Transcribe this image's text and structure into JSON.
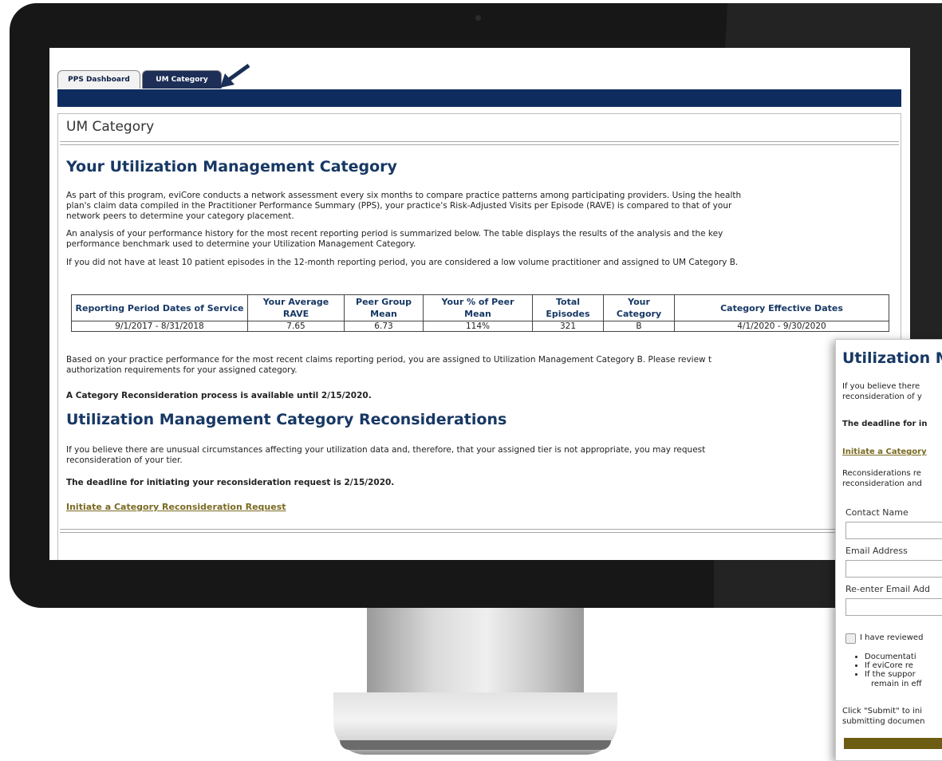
{
  "tabs": [
    {
      "label": "PPS Dashboard"
    },
    {
      "label": "UM Category"
    }
  ],
  "panel": {
    "title": "UM Category"
  },
  "section1": {
    "heading": "Your Utilization Management Category",
    "para1_line1": "As part of this program, eviCore conducts a network assessment every six months to compare practice patterns among participating providers. Using the health",
    "para1_line2": "plan's claim data compiled in the Practitioner Performance Summary (PPS), your practice's Risk-Adjusted Visits per Episode (RAVE) is compared to that of your",
    "para1_line3": "network peers to determine your category placement.",
    "para2_line1": "An analysis of your performance history for the most recent reporting period is summarized below. The table displays the results of the analysis and the key",
    "para2_line2": "performance benchmark used to determine your Utilization Management Category.",
    "para3": "If you did not have at least 10 patient episodes in the 12-month reporting period, you are considered a low volume practitioner and assigned to UM Category B."
  },
  "table": {
    "headers": [
      "Reporting Period Dates of Service",
      "Your Average RAVE",
      "Peer Group Mean",
      "Your % of Peer Mean",
      "Total Episodes",
      "Your Category",
      "Category Effective Dates"
    ],
    "rows": [
      [
        "9/1/2017 - 8/31/2018",
        "7.65",
        "6.73",
        "114%",
        "321",
        "B",
        "4/1/2020 - 9/30/2020"
      ]
    ]
  },
  "section2": {
    "para_line1": "Based on your practice performance for the most recent claims reporting period, you are assigned to Utilization Management Category B. Please review t",
    "para_line2": "authorization requirements for your assigned category.",
    "availability_note": "A Category Reconsideration process is available until 2/15/2020."
  },
  "section3": {
    "heading": "Utilization Management Category Reconsiderations",
    "para_line1": "If you believe there are unusual circumstances affecting your utilization data and, therefore, that your assigned tier is not appropriate, you may request",
    "para_line2": "reconsideration of your tier.",
    "deadline": "The deadline for initiating your reconsideration request is 2/15/2020.",
    "link": "Initiate a Category Reconsideration Request"
  },
  "popup": {
    "title": "Utilization M",
    "intro_line1": "If you believe there",
    "intro_line2": "reconsideration of y",
    "deadline": "The deadline for in",
    "link": "Initiate a Category",
    "note_line1": "Reconsiderations re",
    "note_line2": "reconsideration and",
    "contact_label": "Contact Name",
    "email_label": "Email Address",
    "reemail_label": "Re-enter Email Add",
    "checkbox_label": "I have reviewed",
    "bullets": [
      "Documentati",
      "If eviCore re",
      "If the suppor"
    ],
    "bullet3_cont": "remain in eff",
    "footer_line1": "Click \"Submit\" to ini",
    "footer_line2": "submitting documen"
  }
}
